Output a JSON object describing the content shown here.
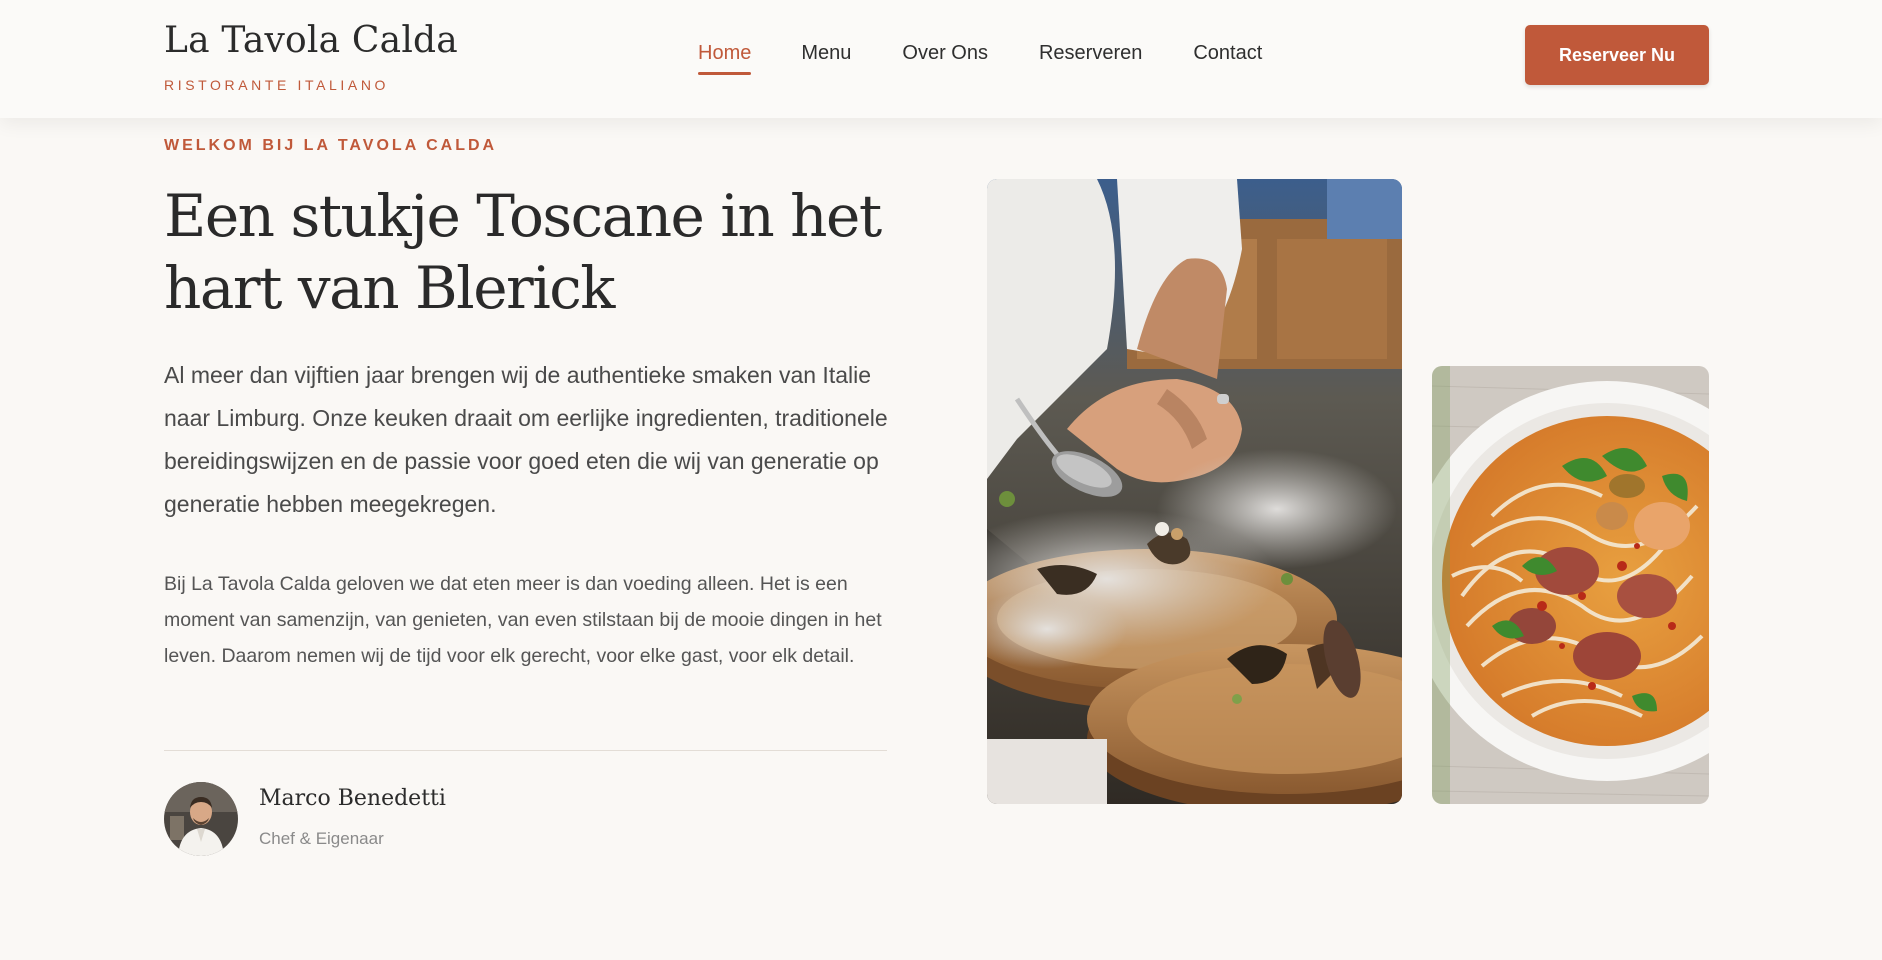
{
  "header": {
    "brand_name": "La Tavola Calda",
    "brand_sub": "RISTORANTE ITALIANO",
    "nav": [
      {
        "label": "Home",
        "active": true
      },
      {
        "label": "Menu",
        "active": false
      },
      {
        "label": "Over Ons",
        "active": false
      },
      {
        "label": "Reserveren",
        "active": false
      },
      {
        "label": "Contact",
        "active": false
      }
    ],
    "cta_label": "Reserveer Nu"
  },
  "hero": {
    "eyebrow": "WELKOM BIJ LA TAVOLA CALDA",
    "title": "Een stukje Toscane in het hart van Blerick",
    "lead": "Al meer dan vijftien jaar brengen wij de authentieke smaken van Italie naar Limburg. Onze keuken draait om eerlijke ingredienten, traditionele bereidingswijzen en de passie voor goed eten die wij van generatie op generatie hebben meegekregen.",
    "body": "Bij La Tavola Calda geloven we dat eten meer is dan voeding alleen. Het is een moment van samenzijn, van genieten, van even stilstaan bij de mooie dingen in het leven. Daarom nemen wij de tijd voor elk gerecht, voor elke gast, voor elk detail."
  },
  "chef": {
    "name": "Marco Benedetti",
    "role": "Chef & Eigenaar"
  },
  "colors": {
    "accent": "#c0593a",
    "background": "#faf8f5",
    "text": "#2b2b2b"
  }
}
